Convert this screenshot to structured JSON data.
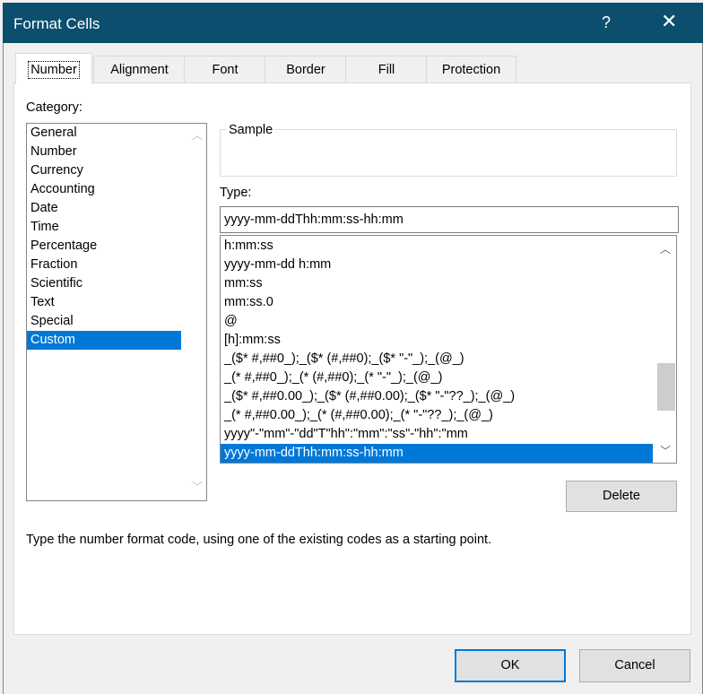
{
  "window": {
    "title": "Format Cells",
    "help": "?",
    "close": "✕"
  },
  "tabs": [
    {
      "label": "Number"
    },
    {
      "label": "Alignment"
    },
    {
      "label": "Font"
    },
    {
      "label": "Border"
    },
    {
      "label": "Fill"
    },
    {
      "label": "Protection"
    }
  ],
  "category": {
    "label": "Category:",
    "items": [
      "General",
      "Number",
      "Currency",
      "Accounting",
      "Date",
      "Time",
      "Percentage",
      "Fraction",
      "Scientific",
      "Text",
      "Special",
      "Custom"
    ],
    "selected": "Custom"
  },
  "sample": {
    "label": "Sample"
  },
  "type": {
    "label": "Type:",
    "value": "yyyy-mm-ddThh:mm:ss-hh:mm",
    "items": [
      "h:mm:ss",
      "yyyy-mm-dd h:mm",
      "mm:ss",
      "mm:ss.0",
      "@",
      "[h]:mm:ss",
      "_($* #,##0_);_($* (#,##0);_($* \"-\"_);_(@_)",
      "_(* #,##0_);_(* (#,##0);_(* \"-\"_);_(@_)",
      "_($* #,##0.00_);_($* (#,##0.00);_($* \"-\"??_);_(@_)",
      "_(* #,##0.00_);_(* (#,##0.00);_(* \"-\"??_);_(@_)",
      "yyyy\"-\"mm\"-\"dd\"T\"hh\":\"mm\":\"ss\"-\"hh\":\"mm",
      "yyyy-mm-ddThh:mm:ss-hh:mm"
    ],
    "selected_index": 11
  },
  "delete_label": "Delete",
  "description": "Type the number format code, using one of the existing codes as a starting point.",
  "ok_label": "OK",
  "cancel_label": "Cancel"
}
